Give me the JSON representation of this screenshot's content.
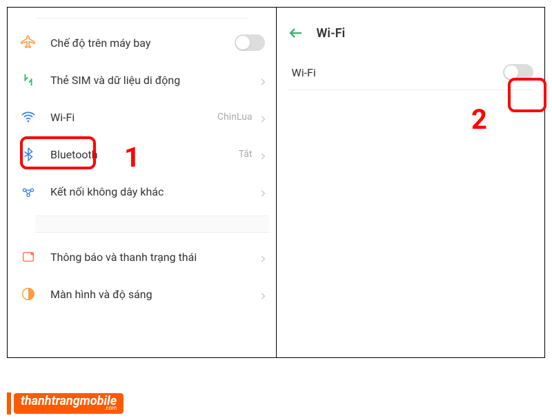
{
  "left": {
    "airplane": "Chế độ trên máy bay",
    "sim": "Thẻ SIM và dữ liệu di động",
    "wifi": "Wi-Fi",
    "wifi_value": "ChinLua",
    "bluetooth": "Bluetooth",
    "bluetooth_value": "Tắt",
    "wireless": "Kết nối không dây khác",
    "notification": "Thông báo và thanh trạng thái",
    "display": "Màn hình và độ sáng"
  },
  "right": {
    "title": "Wi-Fi",
    "wifi_label": "Wi-Fi"
  },
  "annotations": {
    "step1": "1",
    "step2": "2"
  },
  "watermark": {
    "brand": "thanhtrangmobile",
    "suffix": ".com"
  },
  "icons": {
    "airplane": "airplane-icon",
    "sim": "sim-icon",
    "wifi": "wifi-icon",
    "bluetooth": "bluetooth-icon",
    "wireless": "wireless-icon",
    "notification": "notification-icon",
    "display": "display-icon"
  },
  "colors": {
    "accent": "#ff0000",
    "brand": "#ff5a00"
  }
}
